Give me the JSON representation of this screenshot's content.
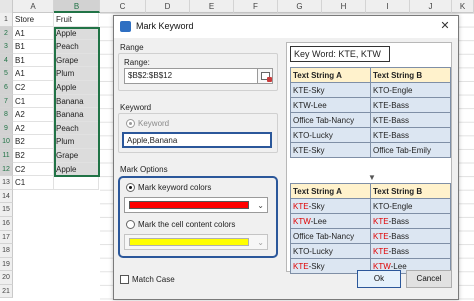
{
  "sheet": {
    "columns": [
      "A",
      "B",
      "C",
      "D",
      "E",
      "F",
      "G",
      "H",
      "I",
      "J",
      "K"
    ],
    "rows": [
      "1",
      "2",
      "3",
      "4",
      "5",
      "6",
      "7",
      "8",
      "9",
      "10",
      "11",
      "12",
      "13",
      "14",
      "15",
      "16",
      "17",
      "18",
      "19",
      "20",
      "21"
    ],
    "data": [
      [
        "Store",
        "Fruit"
      ],
      [
        "A1",
        "Apple"
      ],
      [
        "B1",
        "Peach"
      ],
      [
        "B1",
        "Grape"
      ],
      [
        "A1",
        "Plum"
      ],
      [
        "C2",
        "Apple"
      ],
      [
        "C1",
        "Banana"
      ],
      [
        "A2",
        "Banana"
      ],
      [
        "A2",
        "Peach"
      ],
      [
        "B2",
        "Plum"
      ],
      [
        "B2",
        "Grape"
      ],
      [
        "C2",
        "Apple"
      ],
      [
        "C1",
        ""
      ]
    ]
  },
  "dialog": {
    "title": "Mark Keyword",
    "close_glyph": "✕",
    "range_group_label": "Range",
    "range_label": "Range:",
    "range_value": "$B$2:$B$12",
    "keyword_group_label": "Keyword",
    "keyword_radio_label": "Keyword",
    "keyword_value": "Apple,Banana",
    "mark_options_label": "Mark Options",
    "mark_keyword_colors_label": "Mark keyword colors",
    "mark_cell_content_label": "Mark the cell content colors",
    "keyword_color": "#ff0000",
    "cell_content_color": "#ffff00",
    "match_case_label": "Match Case",
    "ok_label": "Ok",
    "cancel_label": "Cancel",
    "dropdown_glyph": "⌄"
  },
  "preview": {
    "keyword_title": "Key Word: KTE, KTW",
    "header_a": "Text String A",
    "header_b": "Text String B",
    "before_rows": [
      [
        "KTE-Sky",
        "KTO-Engle"
      ],
      [
        "KTW-Lee",
        "KTE-Bass"
      ],
      [
        "Office Tab-Nancy",
        "KTE-Bass"
      ],
      [
        "KTO-Lucky",
        "KTE-Bass"
      ],
      [
        "KTE-Sky",
        "Office Tab-Emily"
      ]
    ],
    "after_rows": [
      [
        [
          "KTE",
          "-Sky"
        ],
        [
          "",
          "KTO-Engle"
        ]
      ],
      [
        [
          "KTW",
          "-Lee"
        ],
        [
          "KTE",
          "-Bass"
        ]
      ],
      [
        [
          "",
          "Office Tab-Nancy"
        ],
        [
          "KTE",
          "-Bass"
        ]
      ],
      [
        [
          "",
          "KTO-Lucky"
        ],
        [
          "KTE",
          "-Bass"
        ]
      ],
      [
        [
          "KTE",
          "-Sky"
        ],
        [
          "KTW",
          "-Lee"
        ]
      ]
    ],
    "arrow_glyph": "▼",
    "highlight_color": "#e00000"
  }
}
